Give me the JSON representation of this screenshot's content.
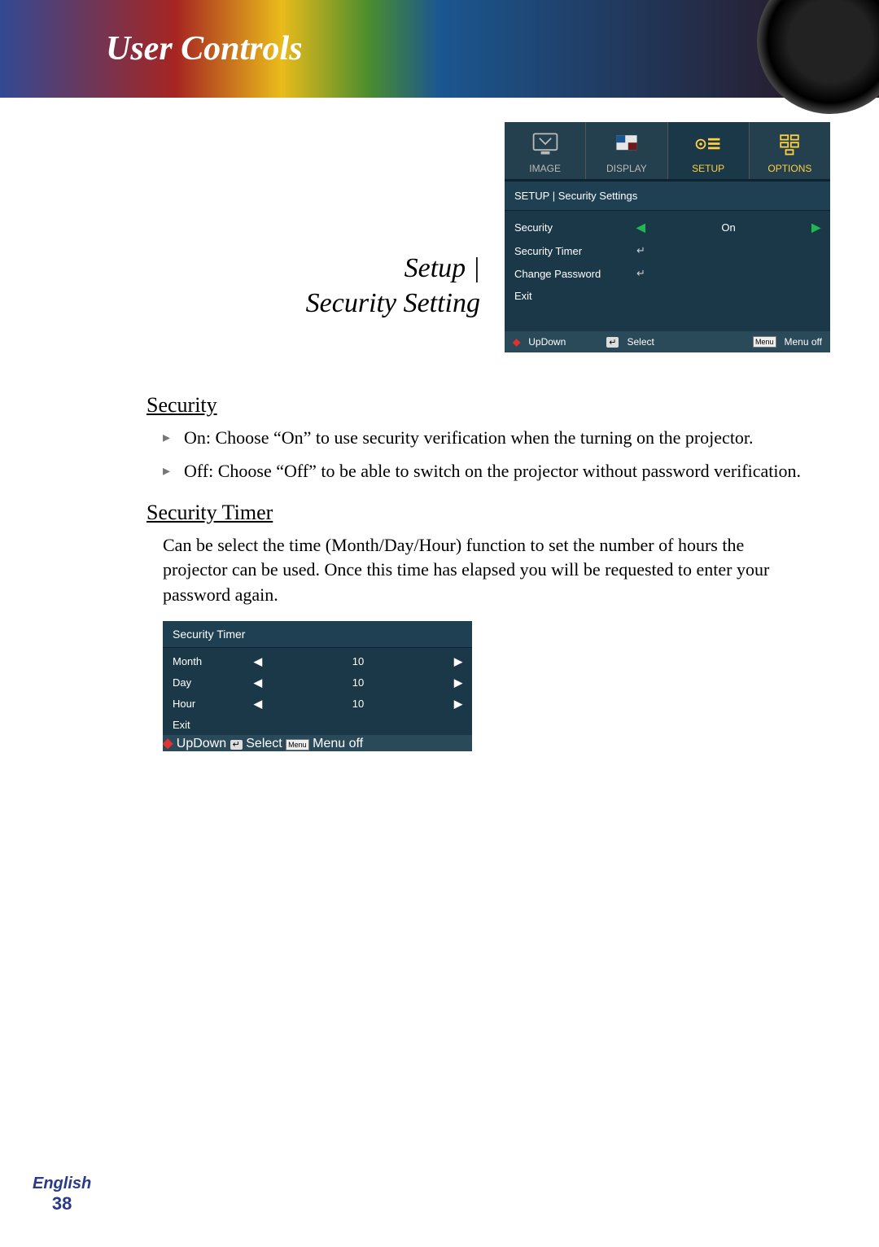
{
  "header": {
    "title": "User Controls"
  },
  "section_title": "Setup |\nSecurity Setting",
  "osd": {
    "tabs": [
      {
        "label": "IMAGE"
      },
      {
        "label": "DISPLAY"
      },
      {
        "label": "SETUP"
      },
      {
        "label": "OPTIONS"
      }
    ],
    "breadcrumb": "SETUP | Security Settings",
    "items": [
      {
        "label": "Security",
        "type": "value",
        "value": "On"
      },
      {
        "label": "Security Timer",
        "type": "enter"
      },
      {
        "label": "Change Password",
        "type": "enter"
      },
      {
        "label": "Exit",
        "type": "none"
      }
    ],
    "legend": {
      "updown": "UpDown",
      "select": "Select",
      "menuoff": "Menu off",
      "menu_label": "Menu"
    }
  },
  "security": {
    "heading": "Security",
    "bullets": [
      "On: Choose “On” to use security verification when the turning on the projector.",
      "Off: Choose “Off” to be able to switch on the projector without password verification."
    ]
  },
  "security_timer": {
    "heading": "Security Timer",
    "paragraph": "Can be select the time (Month/Day/Hour) function to set the number of hours the projector can be used. Once this time has elapsed you will be requested to enter your password again.",
    "osd_title": "Security Timer",
    "items": [
      {
        "label": "Month",
        "value": "10"
      },
      {
        "label": "Day",
        "value": "10"
      },
      {
        "label": "Hour",
        "value": "10"
      },
      {
        "label": "Exit",
        "value": ""
      }
    ]
  },
  "footer": {
    "lang": "English",
    "page": "38"
  }
}
